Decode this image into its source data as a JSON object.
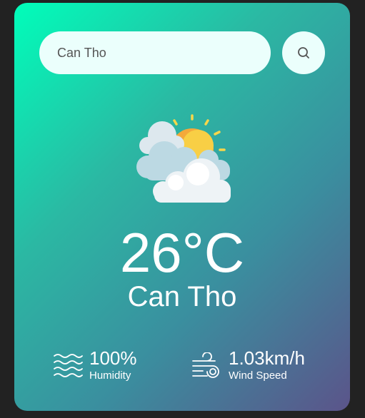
{
  "search": {
    "value": "Can Tho",
    "icon": "search-icon"
  },
  "weather": {
    "icon": "partly-cloudy-icon",
    "temperature": "26°C",
    "city": "Can Tho"
  },
  "details": {
    "humidity": {
      "icon": "waves-icon",
      "value": "100%",
      "label": "Humidity"
    },
    "wind": {
      "icon": "wind-icon",
      "value": "1.03km/h",
      "label": "Wind Speed"
    }
  },
  "colors": {
    "background": "#222222",
    "gradient_start": "#00feba",
    "gradient_end": "#5b548a",
    "input_background": "#ebfffc",
    "text": "#ffffff"
  }
}
